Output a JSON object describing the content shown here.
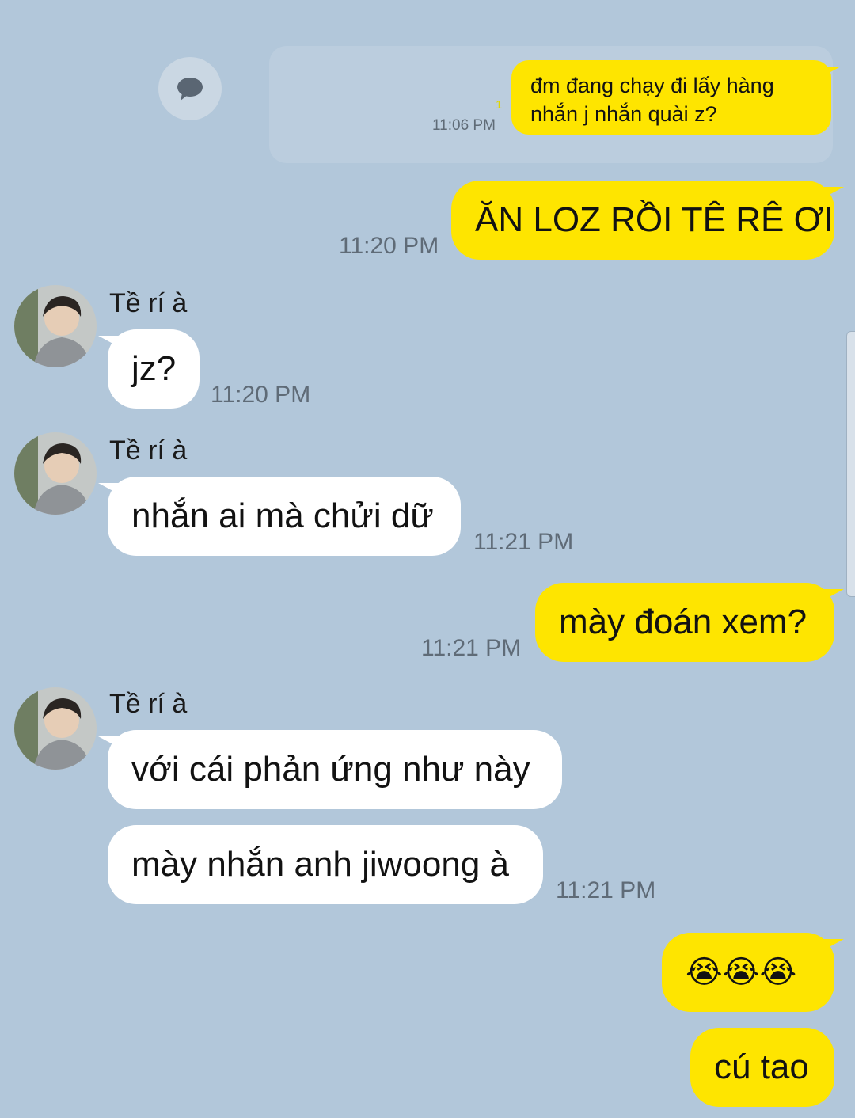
{
  "conversation": {
    "contact_name": "Tề rí à",
    "quoted_message": {
      "text": "đm đang chạy đi lấy hàng nhắn j nhắn quài z?",
      "time": "11:06 PM",
      "unread_count": "1"
    },
    "messages": [
      {
        "sender": "me",
        "text": "ĂN LOZ RỒI TÊ RÊ ƠI",
        "time": "11:20 PM"
      },
      {
        "sender": "them",
        "text": "jz?",
        "time": "11:20 PM"
      },
      {
        "sender": "them",
        "text": "nhắn ai mà chửi dữ",
        "time": "11:21 PM"
      },
      {
        "sender": "me",
        "text": "mày đoán xem?",
        "time": "11:21 PM"
      },
      {
        "sender": "them",
        "text": "với cái phản ứng như này",
        "time": ""
      },
      {
        "sender": "them",
        "text": "mày nhắn anh jiwoong à",
        "time": "11:21 PM"
      },
      {
        "sender": "me",
        "text": "😭😭😭",
        "time": ""
      },
      {
        "sender": "me",
        "text": "cú tao",
        "time": ""
      }
    ]
  },
  "icons": {
    "chat_bubble": "speech-bubble-icon",
    "avatar": "contact-avatar"
  },
  "colors": {
    "background": "#b2c7da",
    "my_bubble": "#fee500",
    "their_bubble": "#ffffff",
    "timestamp": "#5f6b77"
  }
}
